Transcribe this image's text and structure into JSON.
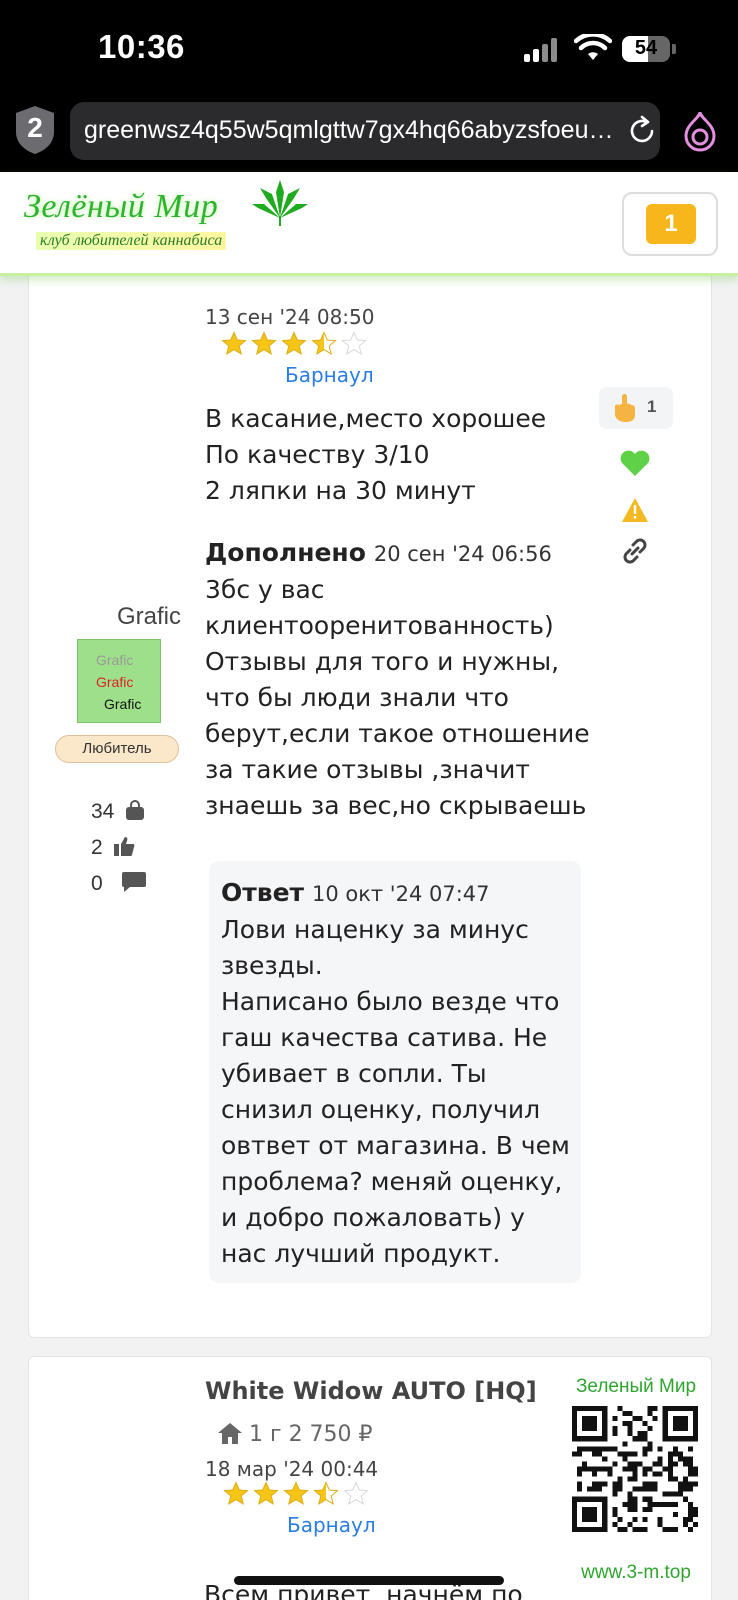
{
  "status_bar": {
    "time": "10:36",
    "battery": "54",
    "battery_level": 0.54
  },
  "browser": {
    "tab_count": "2",
    "url": "greenwsz4q55w5qmlgttw7gx4hq66abyzsfoeu…"
  },
  "site": {
    "logo_title": "Зелёный Мир",
    "logo_subtitle": "клуб любителей каннабиса",
    "notifications": "1"
  },
  "review1": {
    "date": "13 сен '24 08:50",
    "rating": 3.5,
    "city": "Барнаул",
    "text_lines": [
      "В касание,место хорошее",
      "По качеству 3/10",
      "2 ляпки на 30 минут"
    ],
    "addendum_label": "Дополнено",
    "addendum_date": "20 сен '24 06:56",
    "addendum_lines": [
      "3бс у вас",
      "клиентооренитованность)",
      "Отзывы для того и нужны,",
      "что бы люди знали что",
      "берут,если такое отношение",
      "за такие отзывы ,значит",
      "знаешь за вес,но скрываешь"
    ],
    "reply_label": "Ответ",
    "reply_date": "10 окт '24 07:47",
    "reply_lines": [
      "Лови наценку за минус",
      "звезды.",
      "Написано было везде что",
      "гаш качества сатива. Не",
      "убивает в сопли. Ты",
      "снизил оценку, получил",
      "овтвет от магазина. В чем",
      "проблема? меняй оценку,",
      "и добро пожаловать) у",
      "нас лучший продукт."
    ],
    "reaction_count": "1",
    "user": {
      "name": "Grafic",
      "avatar_text": [
        "Grafic",
        "Grafic",
        "Grafic"
      ],
      "rank": "Любитель",
      "purchases": "34",
      "likes": "2",
      "comments": "0"
    }
  },
  "review2": {
    "product": "White Widow AUTO [HQ]",
    "amount": "1 г",
    "price": "2 750 ₽",
    "date": "18 мар '24 00:44",
    "rating": 3.5,
    "city": "Барнаул",
    "peek_text": "Всем привет, начнём по"
  },
  "watermark": {
    "title": "Зеленый Мир",
    "url": "www.3-m.top"
  },
  "colors": {
    "accent_green": "#2db52d",
    "link_blue": "#2a7de1",
    "badge_yellow": "#f6b61c",
    "star": "#f5c518"
  }
}
